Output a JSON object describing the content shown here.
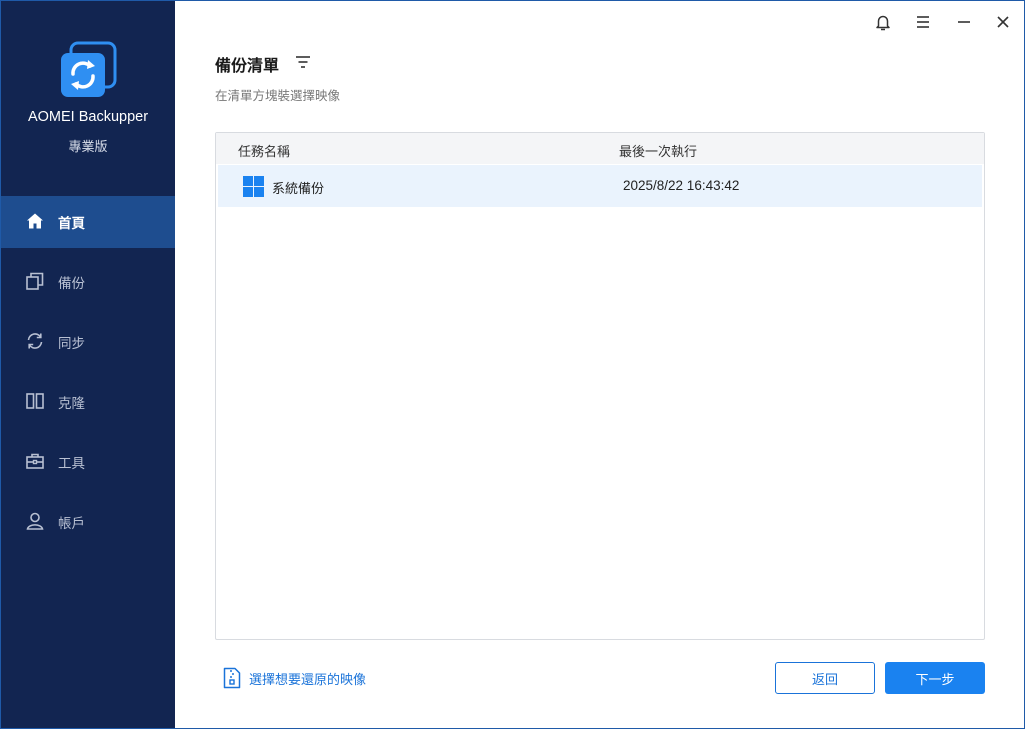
{
  "app": {
    "name": "AOMEI Backupper",
    "edition": "專業版"
  },
  "titlebar": {
    "icons": [
      "bell-icon",
      "menu-icon",
      "minimize-icon",
      "close-icon"
    ]
  },
  "sidebar": {
    "items": [
      {
        "label": "首頁",
        "icon": "home-icon",
        "active": true
      },
      {
        "label": "備份",
        "icon": "backup-icon",
        "active": false
      },
      {
        "label": "同步",
        "icon": "sync-icon",
        "active": false
      },
      {
        "label": "克隆",
        "icon": "clone-icon",
        "active": false
      },
      {
        "label": "工具",
        "icon": "toolbox-icon",
        "active": false
      },
      {
        "label": "帳戶",
        "icon": "account-icon",
        "active": false
      }
    ]
  },
  "main": {
    "title": "備份清單",
    "subtitle": "在清單方塊裝選擇映像",
    "table": {
      "columns": [
        "任務名稱",
        "最後一次執行"
      ],
      "rows": [
        {
          "name": "系統備份",
          "last_run": "2025/8/22 16:43:42",
          "icon": "windows-icon"
        }
      ]
    }
  },
  "footer": {
    "restore_link": "選擇想要還原的映像",
    "back_button": "返回",
    "next_button": "下一步"
  },
  "colors": {
    "sidebar_bg": "#122551",
    "sidebar_active": "#1e4d8f",
    "accent": "#1a82f0",
    "link": "#1a73d9"
  }
}
